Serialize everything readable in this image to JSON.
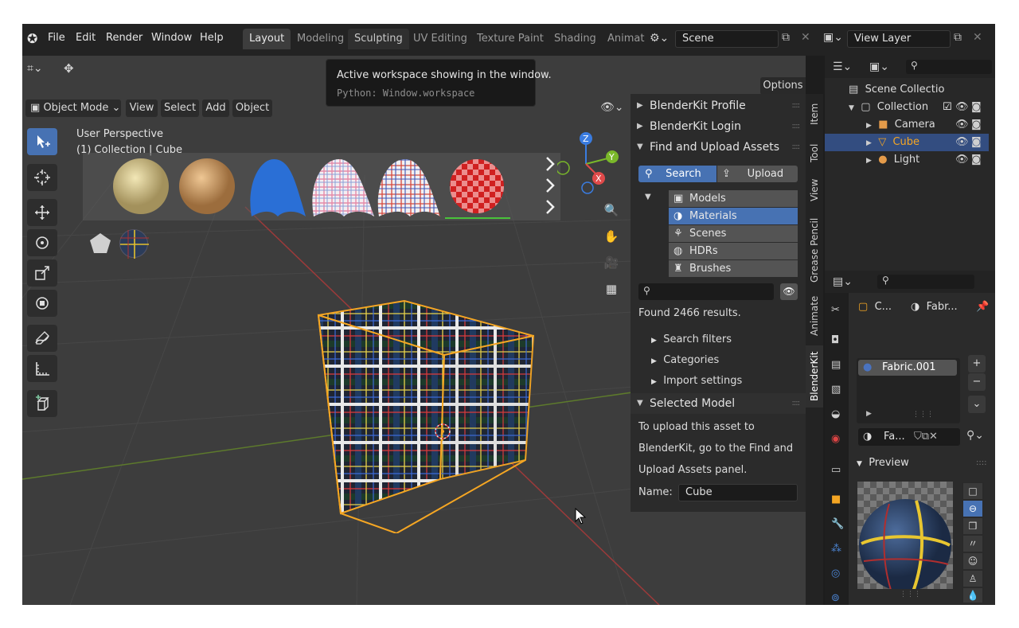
{
  "topbar": {
    "menu": [
      "File",
      "Edit",
      "Render",
      "Window",
      "Help"
    ],
    "workspaces": [
      "Layout",
      "Modeling",
      "Sculpting",
      "UV Editing",
      "Texture Paint",
      "Shading",
      "Animat"
    ],
    "active_workspace": "Layout",
    "scene_name": "Scene",
    "view_layer": "View Layer"
  },
  "header2": {
    "options_label": "Options",
    "mode_label": "Object Mode",
    "menus": [
      "View",
      "Select",
      "Add",
      "Object"
    ]
  },
  "tooltip": {
    "title": "Active workspace showing in the window.",
    "python": "Python: Window.workspace"
  },
  "viewport": {
    "perspective": "User Perspective",
    "collection_info": "(1) Collection | Cube"
  },
  "blenderkit": {
    "profile": "BlenderKit Profile",
    "login": "BlenderKit Login",
    "find_upload": "Find and Upload Assets",
    "search_tab": "Search",
    "upload_tab": "Upload",
    "categories": [
      "Models",
      "Materials",
      "Scenes",
      "HDRs",
      "Brushes"
    ],
    "selected_category": "Materials",
    "found_text": "Found 2466 results.",
    "subsections": [
      "Search filters",
      "Categories",
      "Import settings"
    ],
    "selected_model_title": "Selected Model",
    "upload_hint_lines": [
      "To upload this asset to",
      "BlenderKit, go to the Find and",
      "Upload Assets panel."
    ],
    "name_label": "Name:",
    "name_value": "Cube"
  },
  "vertical_tabs": [
    "Item",
    "Tool",
    "View",
    "Grease Pencil",
    "Animate",
    "BlenderKit"
  ],
  "active_vertical_tab": "BlenderKit",
  "outliner": {
    "items": [
      {
        "label": "Scene Collectio",
        "level": 0
      },
      {
        "label": "Collection",
        "level": 1
      },
      {
        "label": "Camera",
        "level": 2
      },
      {
        "label": "Cube",
        "level": 2,
        "selected": true
      },
      {
        "label": "Light",
        "level": 2
      }
    ]
  },
  "properties": {
    "breadcrumb_obj": "C...",
    "breadcrumb_mat": "Fabr...",
    "material_slot": "Fabric.001",
    "material_field": "Fa...",
    "preview_label": "Preview"
  },
  "colors": {
    "accent": "#4772b3",
    "selection_outline": "#f5a623",
    "background": "#3d3d3d"
  }
}
